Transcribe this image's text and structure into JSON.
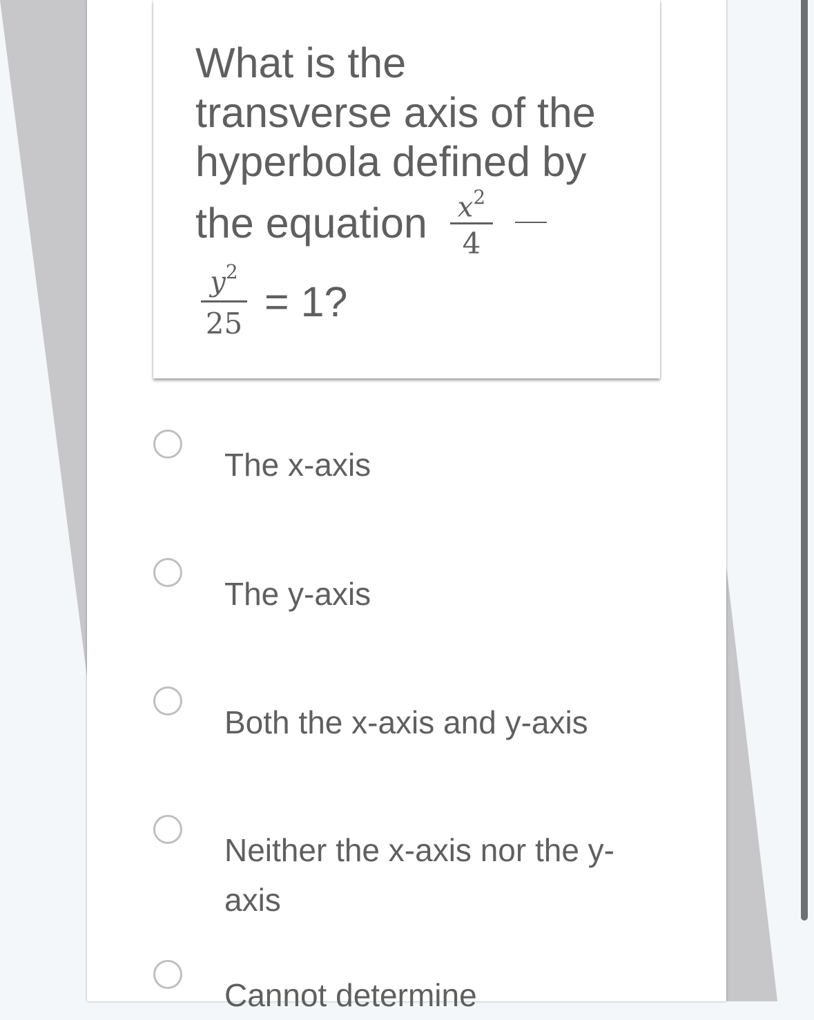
{
  "question": {
    "line1": "What is the",
    "line2": "transverse axis of the",
    "line3": "hyperbola defined by",
    "line4": "the equation",
    "frac1_num": "x",
    "frac1_exp": "2",
    "frac1_den": "4",
    "frac2_num": "y",
    "frac2_exp": "2",
    "frac2_den": "25",
    "tail": "= 1?"
  },
  "options": [
    {
      "label": "The x-axis"
    },
    {
      "label": "The y-axis"
    },
    {
      "label": "Both the x-axis and y-axis"
    },
    {
      "label": "Neither the x-axis nor the y-axis"
    },
    {
      "label": "Cannot determine"
    }
  ],
  "colors": {
    "text": "#5f5f5f",
    "radio_border": "#bfbfbf",
    "background": "#f4f7fa",
    "scrollbar": "#6d6f72"
  }
}
